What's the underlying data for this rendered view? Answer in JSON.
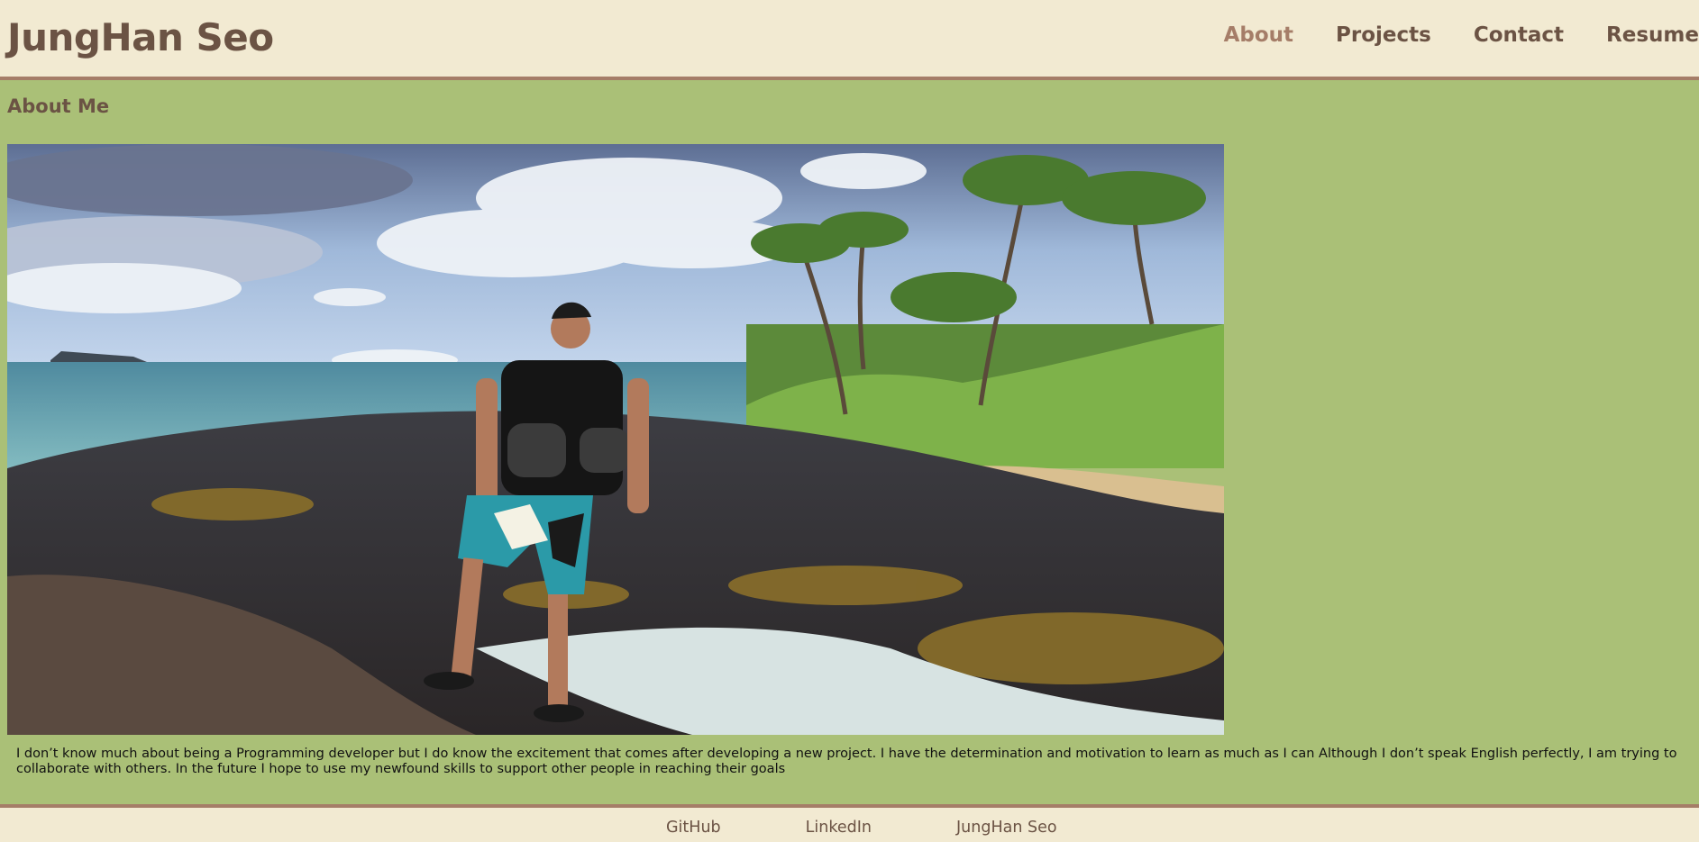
{
  "header": {
    "site_title": "JungHan Seo",
    "nav": [
      {
        "label": "About",
        "active": true
      },
      {
        "label": "Projects",
        "active": false
      },
      {
        "label": "Contact",
        "active": false
      },
      {
        "label": "Resume",
        "active": false
      }
    ]
  },
  "main": {
    "section_title": "About Me",
    "photo_icon": "beach-photo",
    "bio": "I don’t know much about being a Programming developer but I do know the excitement that comes after developing a new project. I have the determination and motivation to learn as much as I can Although I don’t speak English perfectly, I am trying to collaborate with others. In the future I hope to use my newfound skills to support other people in reaching their goals"
  },
  "footer": {
    "links": [
      "GitHub",
      "LinkedIn",
      "JungHan Seo"
    ]
  },
  "colors": {
    "header_bg": "#f2ead2",
    "page_bg": "#aac077",
    "brand_text": "#6b5344",
    "accent": "#a57d68"
  }
}
